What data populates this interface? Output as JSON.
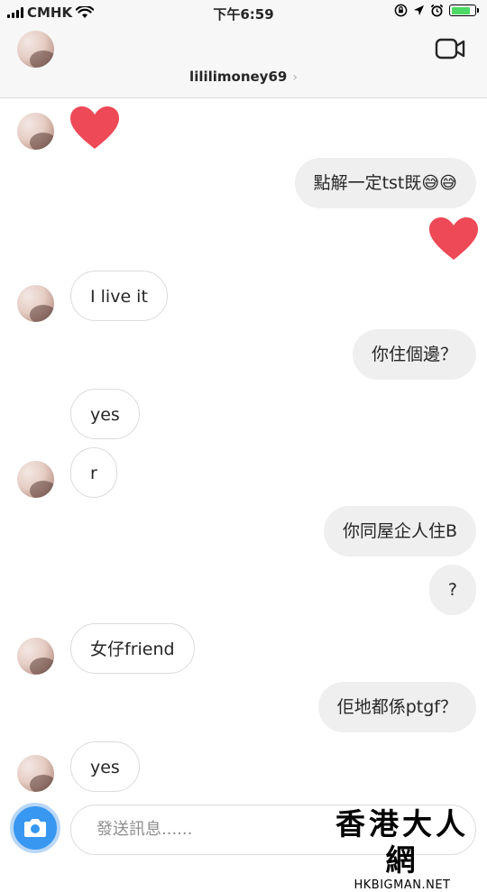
{
  "status_bar": {
    "carrier": "CMHK",
    "time": "下午6:59",
    "battery_level": 0.85,
    "battery_color": "#4cd964"
  },
  "header": {
    "username": "lililimoney69",
    "back_icon": "chevron-left-icon",
    "video_icon": "video-call-icon"
  },
  "messages": [
    {
      "from": "them",
      "type": "heart"
    },
    {
      "from": "me",
      "type": "text",
      "text": "點解一定tst既😅😅"
    },
    {
      "from": "me",
      "type": "heart"
    },
    {
      "from": "them",
      "type": "text",
      "text": "I live it"
    },
    {
      "from": "me",
      "type": "text",
      "text": "你住個邊？"
    },
    {
      "from": "them",
      "type": "text",
      "text": "yes"
    },
    {
      "from": "them",
      "type": "text",
      "text": "r"
    },
    {
      "from": "me",
      "type": "text",
      "text": "你同屋企人住B"
    },
    {
      "from": "me",
      "type": "text",
      "text": "?"
    },
    {
      "from": "them",
      "type": "text",
      "text": "女仔friend"
    },
    {
      "from": "me",
      "type": "text",
      "text": "佢地都係ptgf？"
    },
    {
      "from": "them",
      "type": "text",
      "text": "yes"
    }
  ],
  "composer": {
    "placeholder": "發送訊息......",
    "camera_icon": "camera-icon"
  },
  "watermark": {
    "title": "香港大人網",
    "url": "HKBIGMAN.NET"
  },
  "colors": {
    "heart": "#ed4956",
    "accent": "#3897f0",
    "my_bubble": "#efefef"
  }
}
